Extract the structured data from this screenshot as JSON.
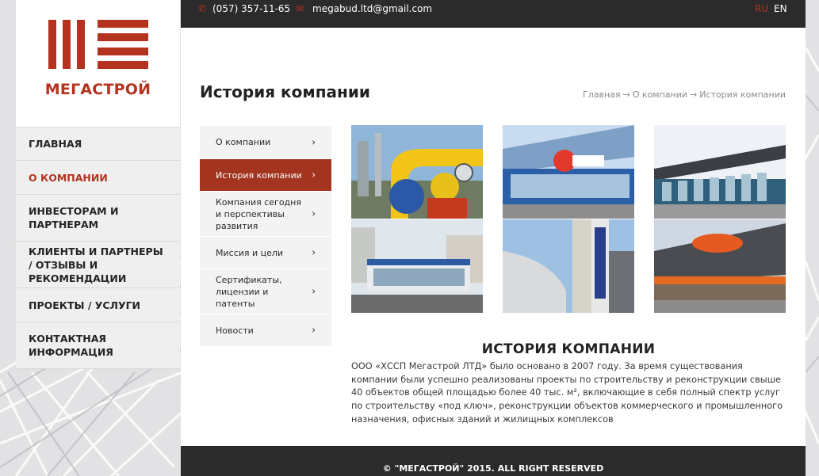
{
  "brand": {
    "name": "МЕГАСТРОЙ",
    "accent_color": "#b5321f",
    "logo_icon": "stacked-bars-logo"
  },
  "topbar": {
    "phone": "(057) 357-11-65",
    "email": "megabud.ltd@gmail.com",
    "phone_icon": "phone-icon",
    "mail_icon": "mail-icon",
    "languages": [
      {
        "code": "RU",
        "active": true
      },
      {
        "code": "EN",
        "active": false
      }
    ]
  },
  "sidebar": {
    "items": [
      {
        "label": "ГЛАВНАЯ",
        "active": false
      },
      {
        "label": "О КОМПАНИИ",
        "active": true
      },
      {
        "label": "ИНВЕСТОРАМ И ПАРТНЕРАМ",
        "active": false
      },
      {
        "label": "КЛИЕНТЫ И ПАРТНЕРЫ / ОТЗЫВЫ И РЕКОМЕНДАЦИИ",
        "active": false
      },
      {
        "label": "ПРОЕКТЫ / УСЛУГИ",
        "active": false
      },
      {
        "label": "КОНТАКТНАЯ ИНФОРМАЦИЯ",
        "active": false
      }
    ]
  },
  "page": {
    "title": "История компании",
    "breadcrumb": [
      "Главная",
      "О компании",
      "История компании"
    ],
    "breadcrumb_separator": "→"
  },
  "subnav": {
    "chevron": "›",
    "items": [
      {
        "label": "О компании",
        "active": false
      },
      {
        "label": "История компании",
        "active": true
      },
      {
        "label": "Компания сегодня и перспективы развития",
        "active": false
      },
      {
        "label": "Миссия и цели",
        "active": false
      },
      {
        "label": "Сертификаты, лицензии и патенты",
        "active": false
      },
      {
        "label": "Новости",
        "active": false
      }
    ]
  },
  "gallery": {
    "photos": [
      {
        "subject": "industrial-pipes-photo"
      },
      {
        "subject": "atb-store-photo"
      },
      {
        "subject": "airport-terminal-photo"
      },
      {
        "subject": "car-showroom-photo"
      },
      {
        "subject": "industrial-chimney-photo"
      },
      {
        "subject": "cinema-building-photo"
      }
    ]
  },
  "about": {
    "title": "ИСТОРИЯ КОМПАНИИ",
    "text": "ООО «ХССП Мегастрой ЛТД» было основано в 2007 году. За время существования компании были успешно реализованы проекты по строительству и реконструкции свыше 40 объектов общей площадью более 40 тыс. м², включающие в себя полный спектр услуг по строительству «под ключ», реконструкции объектов коммерческого и промышленного назначения, офисных зданий и жилищных комплексов"
  },
  "footer": {
    "copyright": "© \"МЕГАСТРОЙ\" 2015. ALL RIGHT RESERVED"
  },
  "colors": {
    "dark_bar": "#2b2b2b",
    "active_tab": "#a23420",
    "page_bg": "#e4e4e6"
  }
}
